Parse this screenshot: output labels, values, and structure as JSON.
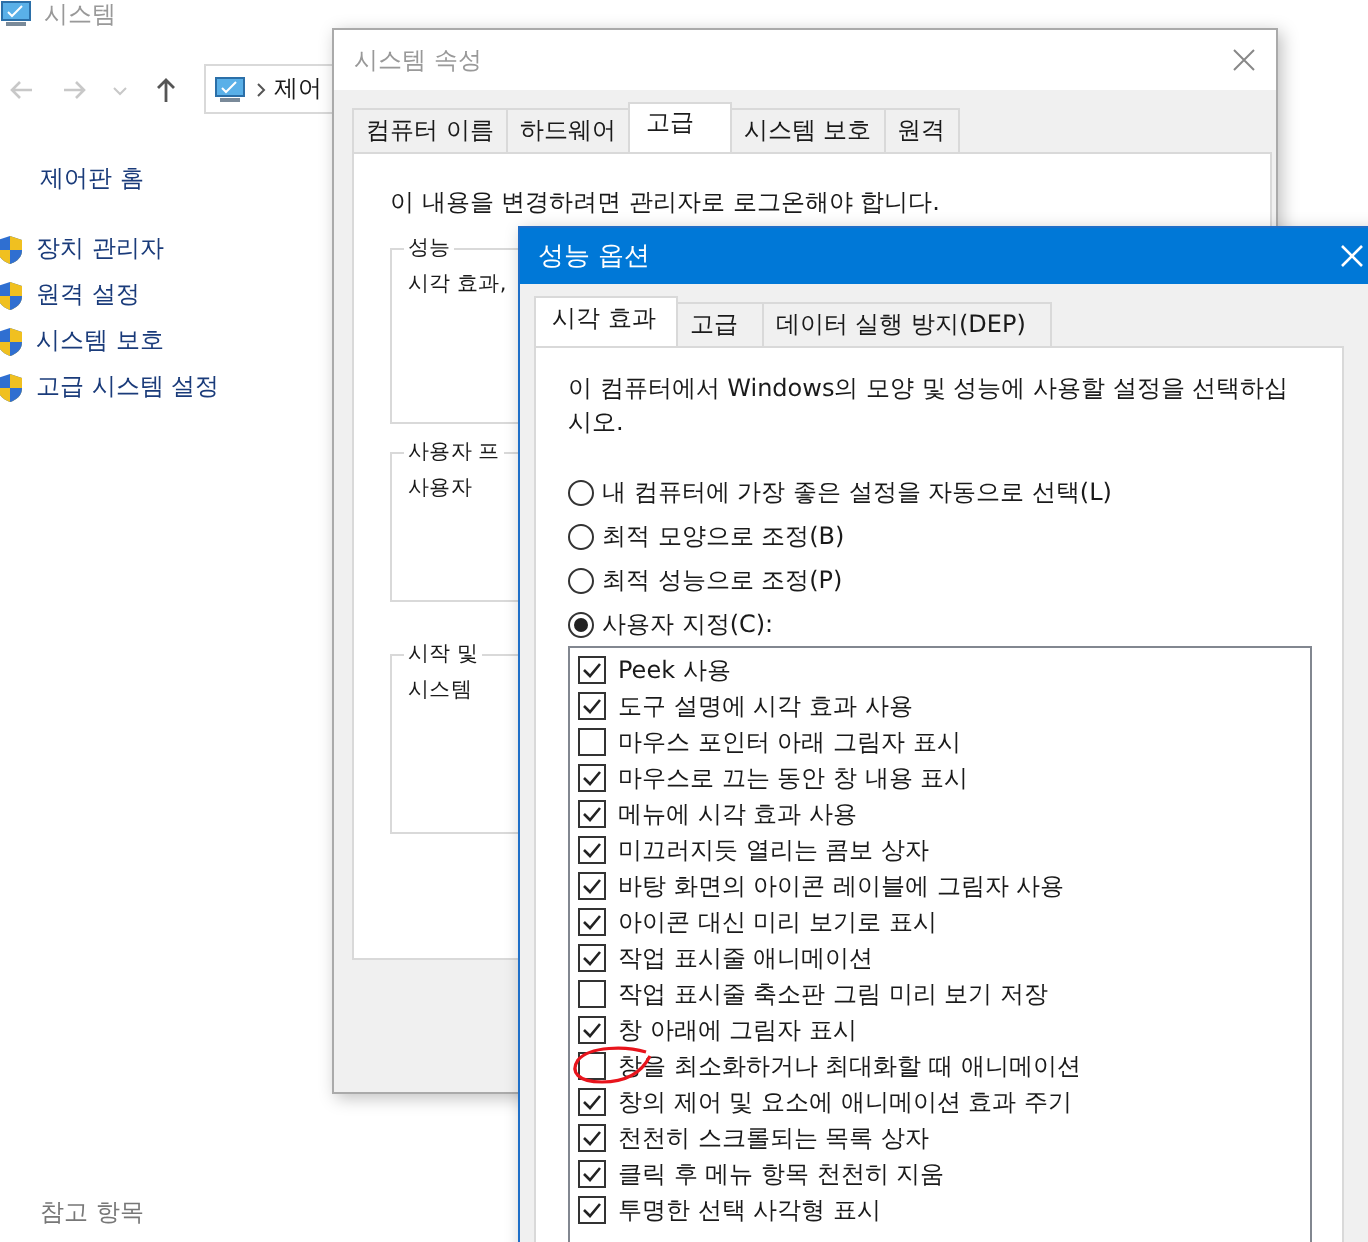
{
  "explorer": {
    "title": "시스템",
    "breadcrumb": "제어",
    "home_link": "제어판 홈",
    "links": [
      "장치 관리자",
      "원격 설정",
      "시스템 보호",
      "고급 시스템 설정"
    ],
    "see_also": "참고 항목"
  },
  "system_properties": {
    "title": "시스템 속성",
    "tabs": [
      {
        "label": "컴퓨터 이름",
        "selected": false
      },
      {
        "label": "하드웨어",
        "selected": false
      },
      {
        "label": "고급",
        "selected": true
      },
      {
        "label": "시스템 보호",
        "selected": false
      },
      {
        "label": "원격",
        "selected": false
      }
    ],
    "notice": "이 내용을 변경하려면 관리자로 로그온해야 합니다.",
    "groups": [
      {
        "title": "성능",
        "text": "시각 효과,"
      },
      {
        "title": "사용자 프",
        "text": "사용자"
      },
      {
        "title": "시작 및",
        "text": "시스템"
      }
    ]
  },
  "performance_options": {
    "title": "성능 옵션",
    "tabs": [
      {
        "label": "시각 효과",
        "selected": true
      },
      {
        "label": "고급",
        "selected": false
      },
      {
        "label": "데이터 실행 방지(DEP)",
        "selected": false
      }
    ],
    "description": "이 컴퓨터에서 Windows의 모양 및 성능에 사용할 설정을 선택하십시오.",
    "radios": [
      {
        "label": "내 컴퓨터에 가장 좋은 설정을 자동으로 선택(L)",
        "selected": false
      },
      {
        "label": "최적 모양으로 조정(B)",
        "selected": false
      },
      {
        "label": "최적 성능으로 조정(P)",
        "selected": false
      },
      {
        "label": "사용자 지정(C):",
        "selected": true
      }
    ],
    "effects": [
      {
        "label": "Peek 사용",
        "checked": true
      },
      {
        "label": "도구 설명에 시각 효과 사용",
        "checked": true
      },
      {
        "label": "마우스 포인터 아래 그림자 표시",
        "checked": false
      },
      {
        "label": "마우스로 끄는 동안 창 내용 표시",
        "checked": true
      },
      {
        "label": "메뉴에 시각 효과 사용",
        "checked": true
      },
      {
        "label": "미끄러지듯 열리는 콤보 상자",
        "checked": true
      },
      {
        "label": "바탕 화면의 아이콘 레이블에 그림자 사용",
        "checked": true
      },
      {
        "label": "아이콘 대신 미리 보기로 표시",
        "checked": true
      },
      {
        "label": "작업 표시줄 애니메이션",
        "checked": true
      },
      {
        "label": "작업 표시줄 축소판 그림 미리 보기 저장",
        "checked": false
      },
      {
        "label": "창 아래에 그림자 표시",
        "checked": true
      },
      {
        "label": "창을 최소화하거나 최대화할 때 애니메이션",
        "checked": false
      },
      {
        "label": "창의 제어 및 요소에 애니메이션 효과 주기",
        "checked": true
      },
      {
        "label": "천천히 스크롤되는 목록 상자",
        "checked": true
      },
      {
        "label": "클릭 후 메뉴 항목 천천히 지움",
        "checked": true
      },
      {
        "label": "투명한 선택 사각형 표시",
        "checked": true
      }
    ]
  }
}
